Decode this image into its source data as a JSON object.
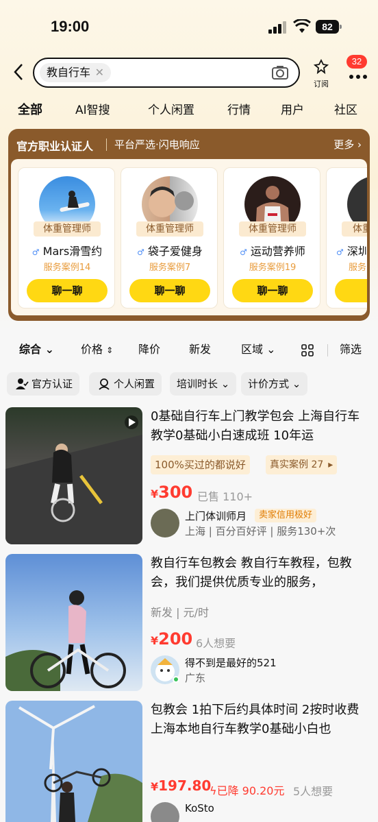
{
  "status": {
    "time": "19:00",
    "battery": "82"
  },
  "search": {
    "query": "教自行车",
    "subscribe": "订阅",
    "badge": "32"
  },
  "tabs": [
    "全部",
    "AI智搜",
    "个人闲置",
    "行情",
    "用户",
    "社区"
  ],
  "cert": {
    "title": "官方职业认证人",
    "slogan": "平台严选·闪电响应",
    "more": "更多",
    "cards": [
      {
        "role": "体重管理师",
        "name": "Mars滑雪约",
        "cases": "服务案例14",
        "chat": "聊一聊"
      },
      {
        "role": "体重管理师",
        "name": "袋子爱健身",
        "cases": "服务案例7",
        "chat": "聊一聊"
      },
      {
        "role": "体重管理师",
        "name": "运动营养师",
        "cases": "服务案例19",
        "chat": "聊一聊"
      },
      {
        "role": "体重",
        "name": "深圳",
        "cases": "服务",
        "chat": "聊"
      }
    ]
  },
  "filters": {
    "sort": "综合",
    "price": "价格",
    "drop": "降价",
    "new": "新发",
    "region": "区域",
    "filter": "筛选"
  },
  "tags": [
    "官方认证",
    "个人闲置",
    "培训时长",
    "计价方式"
  ],
  "items": [
    {
      "title": "0基础自行车上门教学包会 上海自行车教学0基础小白速成班 10年运",
      "praise": "100%买过的都说好",
      "cases": "真实案例 27",
      "price_sym": "¥",
      "price": "300",
      "sold": "已售 110+",
      "seller": "上门体训师月",
      "credit": "卖家信用极好",
      "loc": "上海",
      "rate": "百分百好评",
      "svc": "服务130+次"
    },
    {
      "title": "教自行车包教会 教自行车教程，包教会，我们提供优质专业的服务，",
      "meta1": "新发",
      "meta2": "元/时",
      "price_sym": "¥",
      "price": "200",
      "want": "6人想要",
      "seller": "得不到是最好的521",
      "loc": "广东"
    },
    {
      "title": "包教会 1拍下后约具体时间 2按时收费上海本地自行车教学0基础小白也",
      "price_sym": "¥",
      "price": "197.80",
      "drop": "已降 90.20元",
      "want": "5人想要",
      "seller": "KoSto"
    }
  ],
  "colors": {
    "accent": "#ffd813",
    "price": "#ff3b30",
    "cert_bg": "#8a5a2b"
  }
}
